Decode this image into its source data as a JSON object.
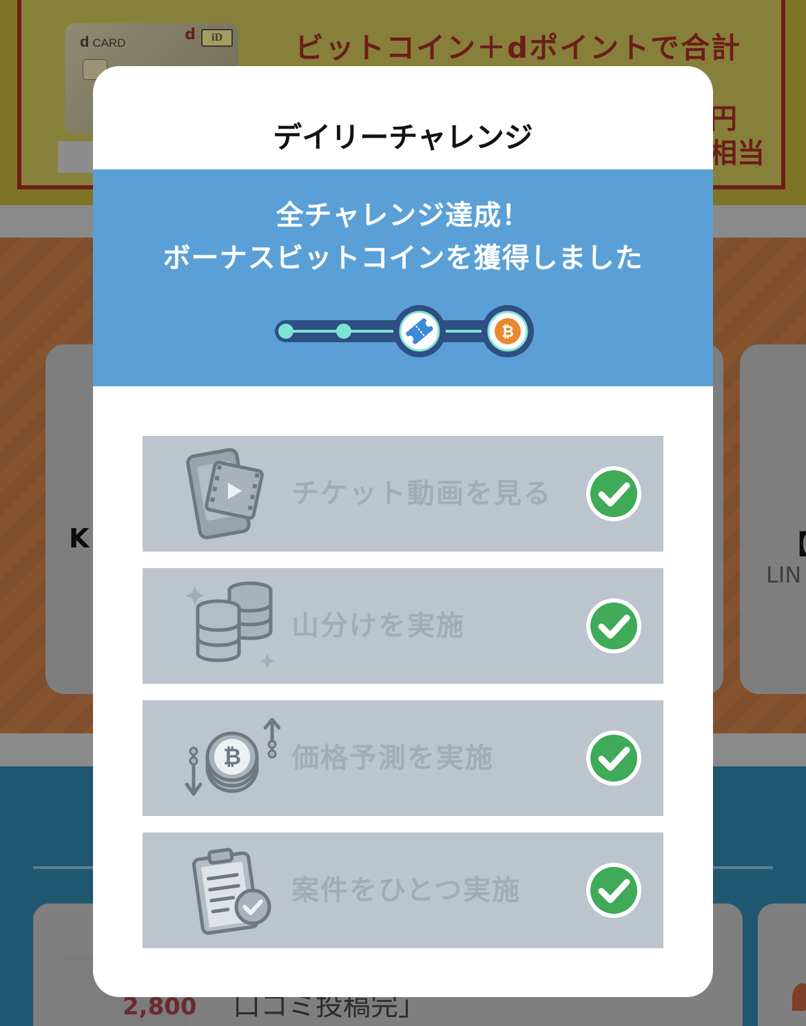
{
  "background": {
    "banner": {
      "card_brand": "CARD",
      "card_id_logo": "iD",
      "card_d_logo": "d",
      "headline": "ビットコイン＋dポイントで合計",
      "fragment_yen": "円",
      "fragment_sou": "相当"
    },
    "tiles": {
      "left_text": "K",
      "right_text": "【L",
      "right_sub": "LIN"
    },
    "bottom": {
      "post_text": "口コミ投稿完」",
      "thumb_text": "2,800"
    }
  },
  "modal": {
    "title": "デイリーチャレンジ",
    "header": {
      "line1": "全チャレンジ達成！",
      "line2": "ボーナスビットコインを獲得しました"
    },
    "progress": {
      "steps_total": 4,
      "steps_completed": 4,
      "step_icons": [
        "dot",
        "dot",
        "ticket-icon",
        "bitcoin-icon"
      ],
      "track_color": "#2f4f82",
      "line_color": "#7ee4d4",
      "bitcoin_color": "#e9892e"
    },
    "challenges": [
      {
        "icon": "video-tablet-icon",
        "label": "チケット動画を見る",
        "completed": true
      },
      {
        "icon": "coin-stacks-icon",
        "label": "山分けを実施",
        "completed": true
      },
      {
        "icon": "price-prediction-icon",
        "label": "価格予測を実施",
        "completed": true
      },
      {
        "icon": "clipboard-check-icon",
        "label": "案件をひとつ実施",
        "completed": true
      }
    ],
    "check_color": "#3faa57"
  }
}
